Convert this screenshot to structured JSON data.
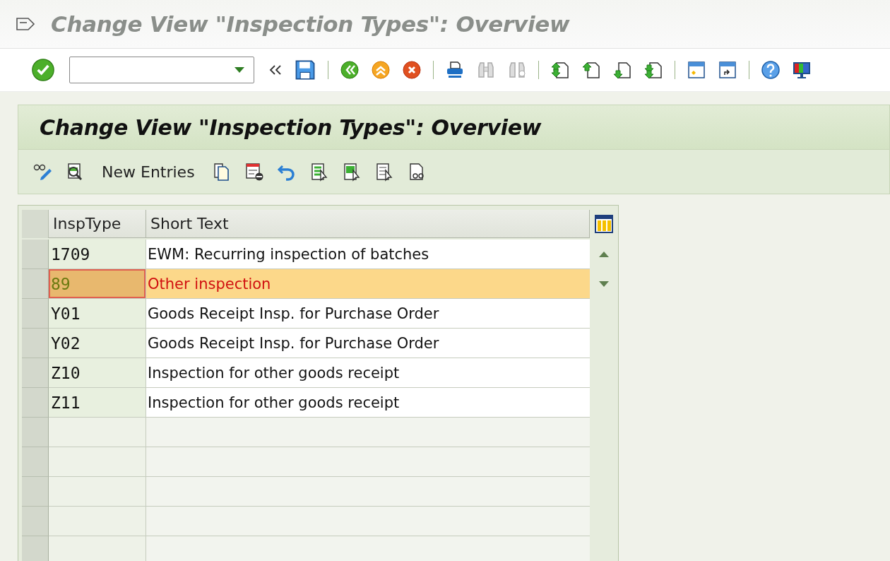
{
  "window": {
    "title": "Change View \"Inspection Types\": Overview"
  },
  "screen": {
    "title": "Change View \"Inspection Types\": Overview"
  },
  "app_toolbar": {
    "new_entries": "New Entries"
  },
  "table": {
    "columns": [
      "InspType",
      "Short Text"
    ],
    "rows": [
      {
        "insp_type": "1709",
        "short_text": "EWM: Recurring inspection of batches",
        "selected": false
      },
      {
        "insp_type": "89",
        "short_text": "Other inspection",
        "selected": true
      },
      {
        "insp_type": "Y01",
        "short_text": "Goods Receipt Insp. for Purchase Order",
        "selected": false
      },
      {
        "insp_type": "Y02",
        "short_text": "Goods Receipt Insp. for Purchase Order",
        "selected": false
      },
      {
        "insp_type": "Z10",
        "short_text": "Inspection for other goods receipt",
        "selected": false
      },
      {
        "insp_type": "Z11",
        "short_text": "Inspection for other goods receipt",
        "selected": false
      }
    ]
  }
}
